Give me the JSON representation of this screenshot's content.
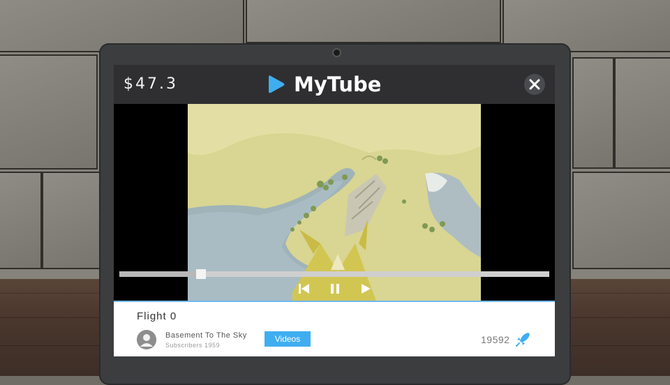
{
  "header": {
    "money": "$47.3",
    "app_name": "MyTube",
    "close_icon": "close-icon"
  },
  "player": {
    "progress": 0.19,
    "controls": [
      "skip-back-icon",
      "pause-icon",
      "play-icon"
    ]
  },
  "video_info": {
    "title": "Flight 0",
    "channel_name": "Basement To The Sky",
    "subscribers": "Subscribers 1959",
    "videos_label": "Videos",
    "views": "19592",
    "views_icon": "rocket-icon"
  },
  "colors": {
    "accent": "#3faef0",
    "logo": "#3faef0",
    "topbar": "#2f2f31"
  }
}
